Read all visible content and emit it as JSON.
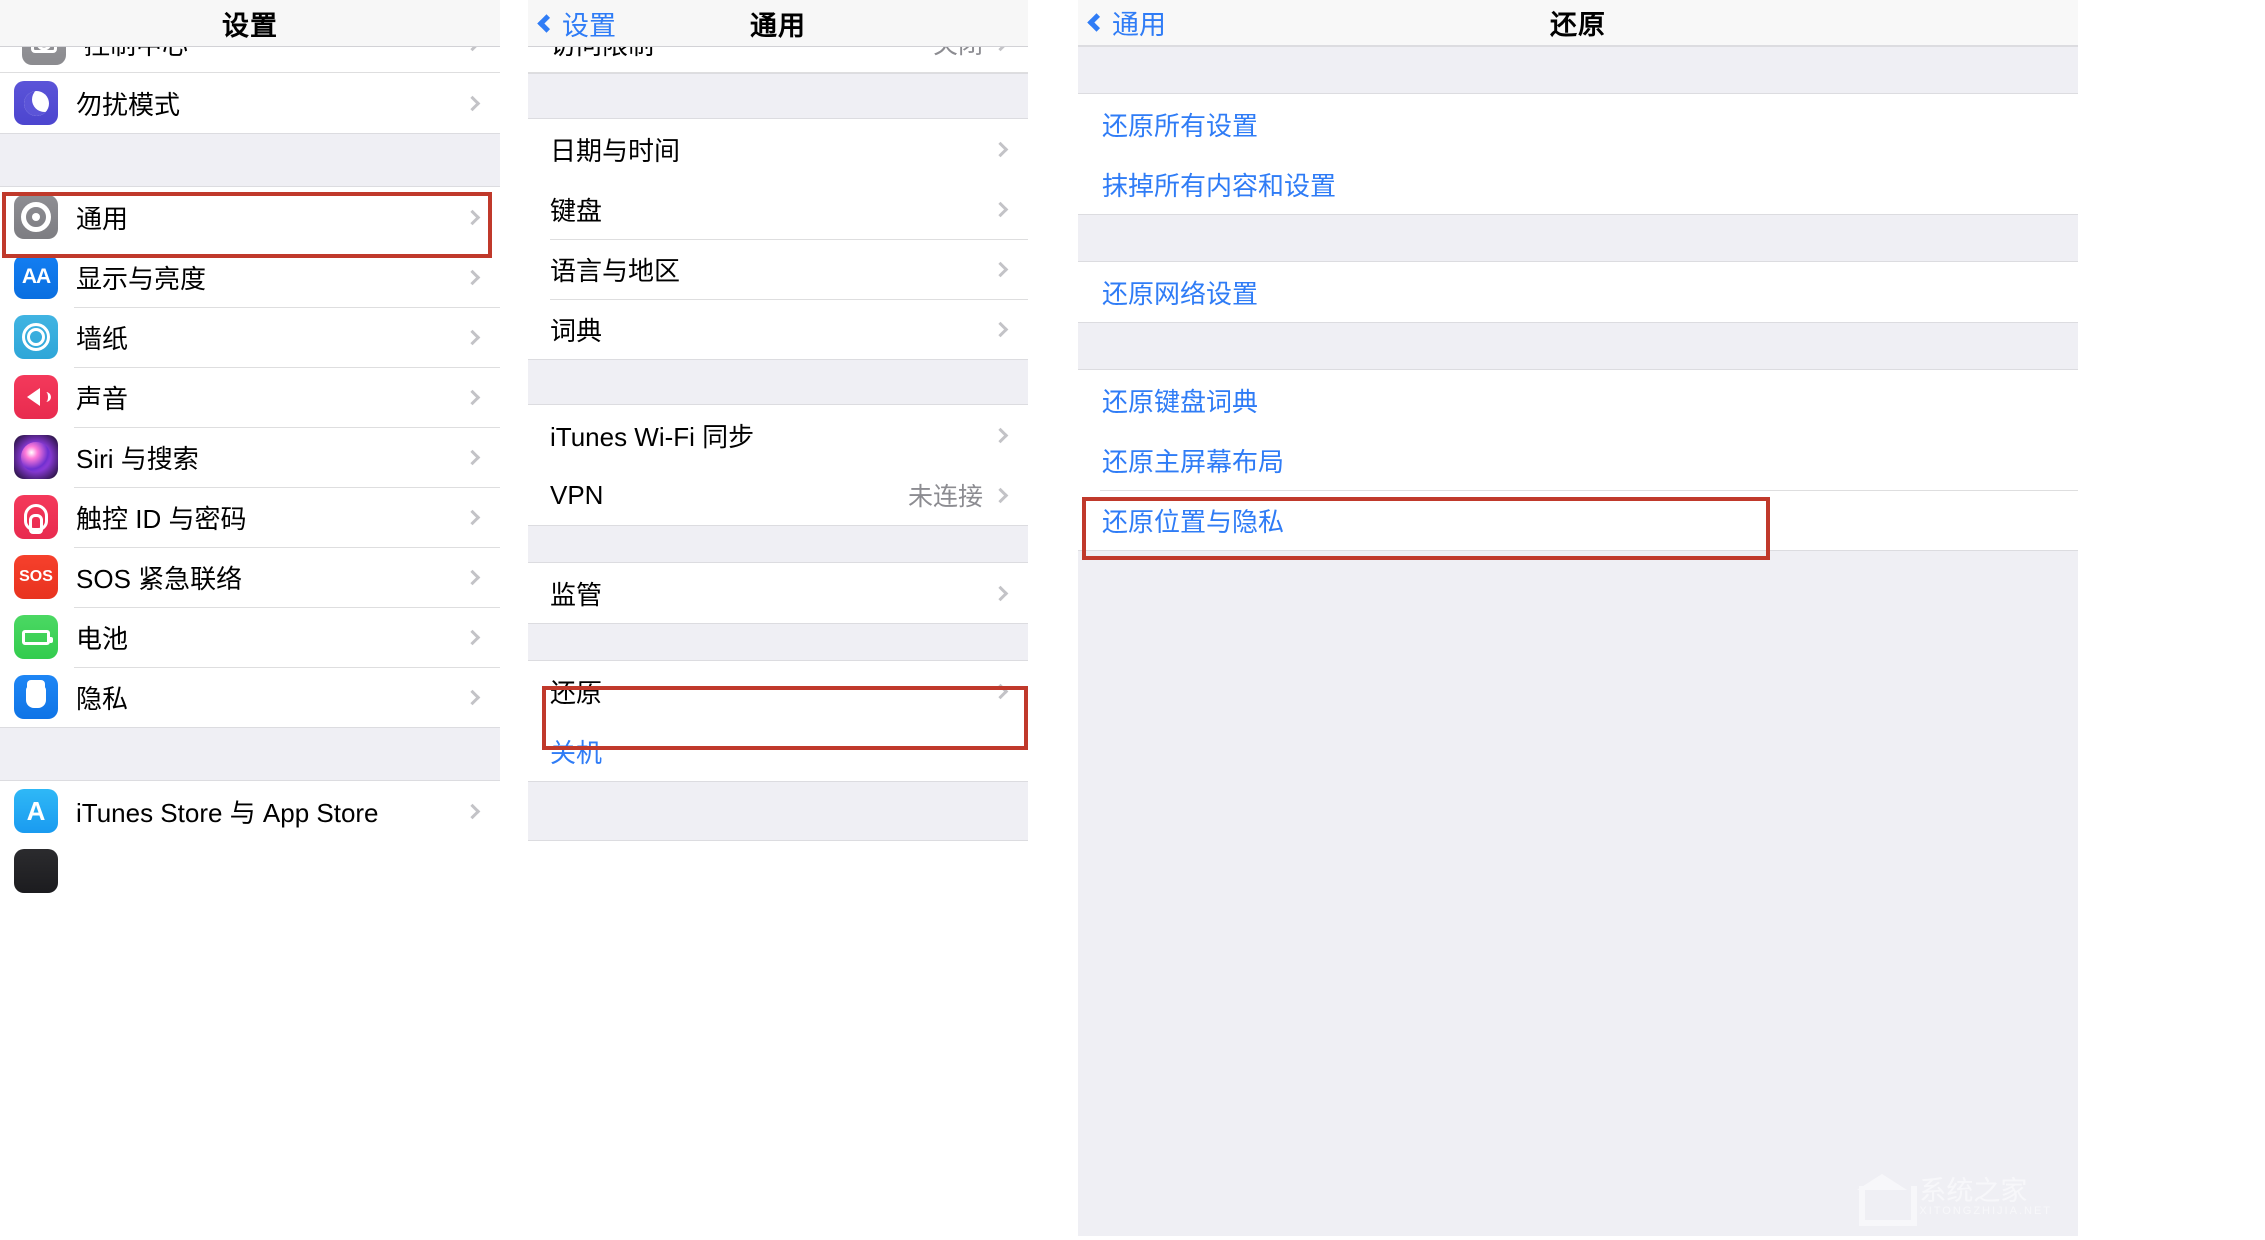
{
  "colors": {
    "accent_blue": "#2f7cf6",
    "highlight_red": "#c0392b",
    "group_bg": "#efeff4",
    "value_grey": "#8c8c91"
  },
  "panel_settings": {
    "nav": {
      "title": "设置"
    },
    "clipped_top_row": {
      "label": "控制中心",
      "icon": "control-center-icon"
    },
    "groups": [
      {
        "rows": [
          {
            "label": "勿扰模式",
            "icon": "do-not-disturb-icon",
            "chevron": true
          }
        ]
      },
      {
        "rows": [
          {
            "label": "通用",
            "icon": "general-gear-icon",
            "chevron": true,
            "highlighted": true
          },
          {
            "label": "显示与亮度",
            "icon": "display-brightness-icon",
            "chevron": true
          },
          {
            "label": "墙纸",
            "icon": "wallpaper-icon",
            "chevron": true
          },
          {
            "label": "声音",
            "icon": "sound-icon",
            "chevron": true
          },
          {
            "label": "Siri 与搜索",
            "icon": "siri-icon",
            "chevron": true
          },
          {
            "label": "触控 ID 与密码",
            "icon": "touch-id-icon",
            "chevron": true
          },
          {
            "label": "SOS 紧急联络",
            "icon": "sos-icon",
            "chevron": true
          },
          {
            "label": "电池",
            "icon": "battery-icon",
            "chevron": true
          },
          {
            "label": "隐私",
            "icon": "privacy-hand-icon",
            "chevron": true
          }
        ]
      },
      {
        "rows": [
          {
            "label": "iTunes Store 与 App Store",
            "icon": "app-store-icon",
            "chevron": true
          }
        ]
      }
    ]
  },
  "panel_general": {
    "nav": {
      "back_label": "设置",
      "title": "通用"
    },
    "clipped_top_row": {
      "label": "访问限制",
      "value": "关闭"
    },
    "groups": [
      {
        "rows": [
          {
            "label": "日期与时间",
            "chevron": true
          },
          {
            "label": "键盘",
            "chevron": true
          },
          {
            "label": "语言与地区",
            "chevron": true
          },
          {
            "label": "词典",
            "chevron": true
          }
        ]
      },
      {
        "rows": [
          {
            "label": "iTunes Wi-Fi 同步",
            "chevron": true
          },
          {
            "label": "VPN",
            "value": "未连接",
            "chevron": true
          }
        ]
      },
      {
        "rows": [
          {
            "label": "监管",
            "chevron": true
          }
        ]
      },
      {
        "rows": [
          {
            "label": "还原",
            "chevron": true,
            "highlighted": true
          }
        ]
      },
      {
        "rows": [
          {
            "label": "关机",
            "blue": true,
            "chevron": false
          }
        ]
      }
    ]
  },
  "panel_reset": {
    "nav": {
      "back_label": "通用",
      "title": "还原"
    },
    "groups": [
      {
        "rows": [
          {
            "label": "还原所有设置",
            "blue": true
          },
          {
            "label": "抹掉所有内容和设置",
            "blue": true
          }
        ]
      },
      {
        "rows": [
          {
            "label": "还原网络设置",
            "blue": true
          }
        ]
      },
      {
        "rows": [
          {
            "label": "还原键盘词典",
            "blue": true
          },
          {
            "label": "还原主屏幕布局",
            "blue": true
          },
          {
            "label": "还原位置与隐私",
            "blue": true,
            "highlighted": true
          }
        ]
      }
    ]
  },
  "watermark": {
    "text": "系统之家",
    "subtext": "XITONGZHIJIA.NET"
  }
}
